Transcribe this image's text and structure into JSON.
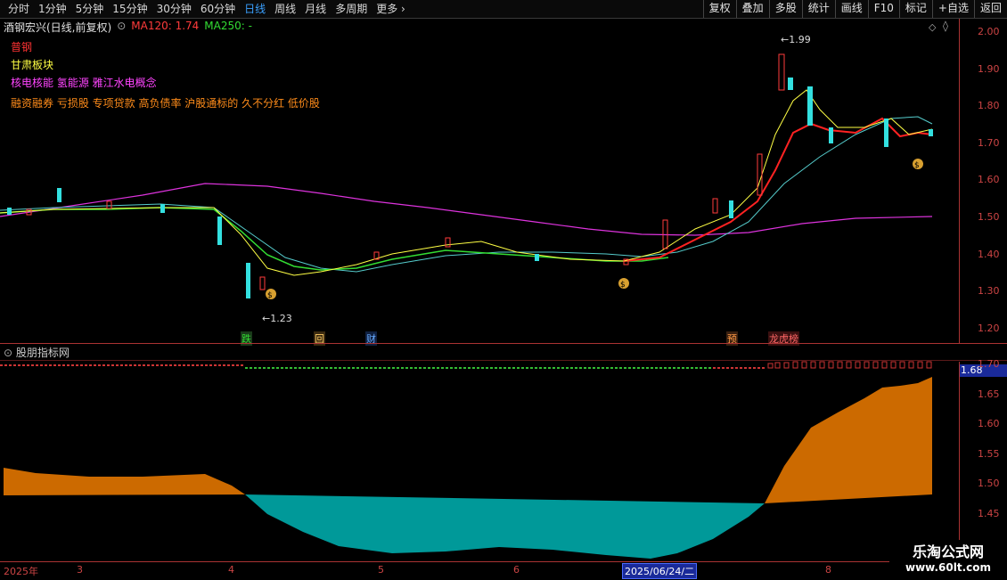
{
  "toolbar": {
    "periods": [
      "分时",
      "1分钟",
      "5分钟",
      "15分钟",
      "30分钟",
      "60分钟",
      "日线",
      "周线",
      "月线",
      "多周期",
      "更多"
    ],
    "active_period": "日线",
    "buttons": [
      "复权",
      "叠加",
      "多股",
      "统计",
      "画线",
      "F10",
      "标记",
      "+自选",
      "返回"
    ]
  },
  "header": {
    "stock_name": "酒钢宏兴(日线,前复权)",
    "ma120": "MA120: 1.74",
    "ma250": "MA250: -"
  },
  "info": {
    "industry": "普钢",
    "region": "甘肃板块",
    "concept": "核电核能 氢能源 雅江水电概念",
    "tags": "融资融券 亏损股 专项贷款 高负债率 沪股通标的 久不分红 低价股"
  },
  "colors": {
    "industry": "#ff3333",
    "region": "#ffff44",
    "concept": "#ff44ff",
    "tags": "#ff8c1a",
    "up": "#ff3b3b",
    "down": "#33e0e0",
    "area_up": "#cc6a00",
    "area_down": "#009999"
  },
  "main_axis": [
    "2.00",
    "1.90",
    "1.80",
    "1.70",
    "1.60",
    "1.50",
    "1.40",
    "1.30",
    "1.20"
  ],
  "sub_axis": [
    "1.70",
    "1.65",
    "1.60",
    "1.55",
    "1.50",
    "1.45"
  ],
  "annotations": {
    "high": "1.99",
    "low": "1.23"
  },
  "markers": [
    {
      "text": "跌",
      "color": "#33dd33"
    },
    {
      "text": "回",
      "color": "#ffcc66"
    },
    {
      "text": "财",
      "color": "#66aaff"
    },
    {
      "text": "预",
      "color": "#ff9944"
    },
    {
      "text": "龙虎榜",
      "color": "#ff6666"
    }
  ],
  "indicator": {
    "title": "股朋指标网",
    "current_value": "1.68"
  },
  "dates": {
    "year": "2025年",
    "m3": "3",
    "m4": "4",
    "m5": "5",
    "m6": "6",
    "selected": "2025/06/24/二",
    "m8": "8"
  },
  "watermark": {
    "line1": "乐淘公式网",
    "line2": "www.60lt.com"
  }
}
